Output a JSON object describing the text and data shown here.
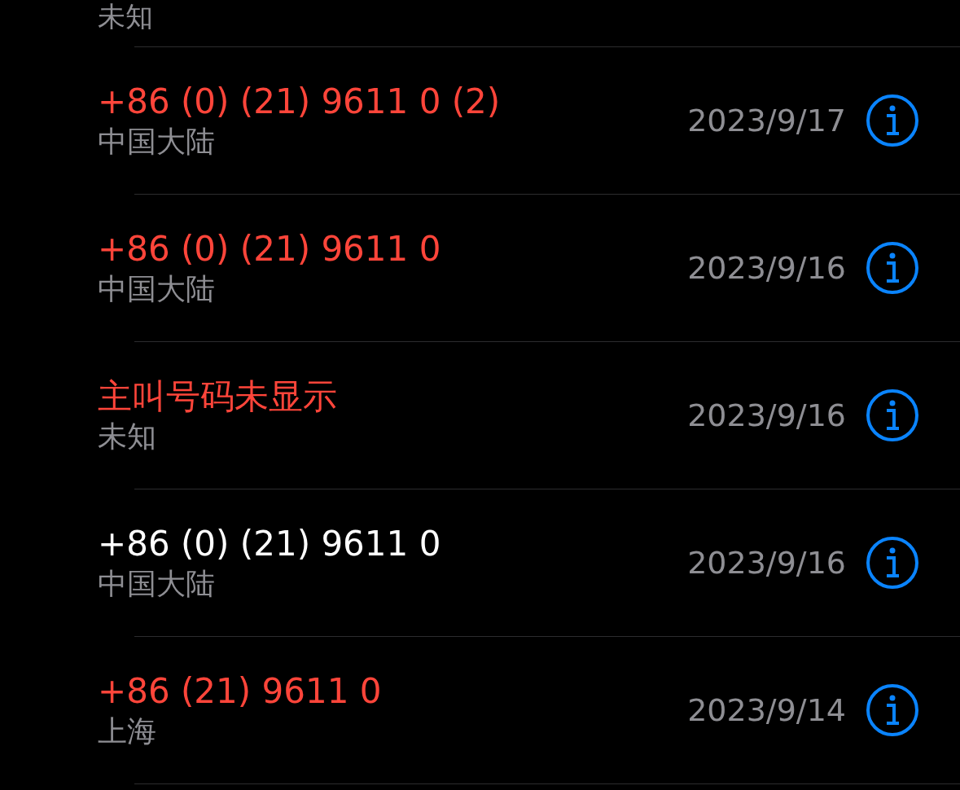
{
  "top_partial": {
    "subtitle": "未知"
  },
  "calls": [
    {
      "number": "+86 (0) (21) 9611 0 (2)",
      "location": "中国大陆",
      "date": "2023/9/17",
      "missed": true
    },
    {
      "number": "+86 (0) (21) 9611 0",
      "location": "中国大陆",
      "date": "2023/9/16",
      "missed": true
    },
    {
      "number": "主叫号码未显示",
      "location": "未知",
      "date": "2023/9/16",
      "missed": true
    },
    {
      "number": "+86 (0) (21) 9611 0",
      "location": "中国大陆",
      "date": "2023/9/16",
      "missed": false
    },
    {
      "number": "+86 (21) 9611 0",
      "location": "上海",
      "date": "2023/9/14",
      "missed": true
    }
  ]
}
